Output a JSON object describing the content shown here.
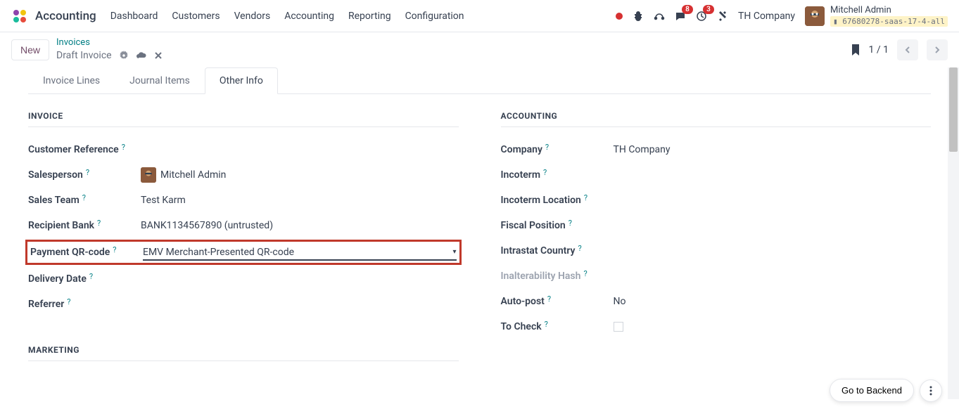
{
  "app_name": "Accounting",
  "menu": [
    "Dashboard",
    "Customers",
    "Vendors",
    "Accounting",
    "Reporting",
    "Configuration"
  ],
  "topbar": {
    "messages_badge": "8",
    "activities_badge": "3",
    "company": "TH Company",
    "user_name": "Mitchell Admin",
    "db_label": "67680278-saas-17-4-all"
  },
  "subbar": {
    "new_label": "New",
    "breadcrumb_parent": "Invoices",
    "breadcrumb_current": "Draft Invoice",
    "pager": "1 / 1"
  },
  "tabs": [
    {
      "label": "Invoice Lines",
      "active": false
    },
    {
      "label": "Journal Items",
      "active": false
    },
    {
      "label": "Other Info",
      "active": true
    }
  ],
  "sections": {
    "invoice": {
      "title": "INVOICE",
      "customer_reference": {
        "label": "Customer Reference",
        "value": ""
      },
      "salesperson": {
        "label": "Salesperson",
        "value": "Mitchell Admin"
      },
      "sales_team": {
        "label": "Sales Team",
        "value": "Test Karm"
      },
      "recipient_bank": {
        "label": "Recipient Bank",
        "value": "BANK1134567890 (untrusted)"
      },
      "payment_qr": {
        "label": "Payment QR-code",
        "value": "EMV Merchant-Presented QR-code"
      },
      "delivery_date": {
        "label": "Delivery Date",
        "value": ""
      },
      "referrer": {
        "label": "Referrer",
        "value": ""
      }
    },
    "accounting": {
      "title": "ACCOUNTING",
      "company": {
        "label": "Company",
        "value": "TH Company"
      },
      "incoterm": {
        "label": "Incoterm",
        "value": ""
      },
      "incoterm_location": {
        "label": "Incoterm Location",
        "value": ""
      },
      "fiscal_position": {
        "label": "Fiscal Position",
        "value": ""
      },
      "intrastat_country": {
        "label": "Intrastat Country",
        "value": ""
      },
      "inalterability_hash": {
        "label": "Inalterability Hash",
        "value": ""
      },
      "auto_post": {
        "label": "Auto-post",
        "value": "No"
      },
      "to_check": {
        "label": "To Check",
        "checked": false
      }
    },
    "marketing": {
      "title": "MARKETING"
    }
  },
  "float": {
    "backend_label": "Go to Backend"
  }
}
